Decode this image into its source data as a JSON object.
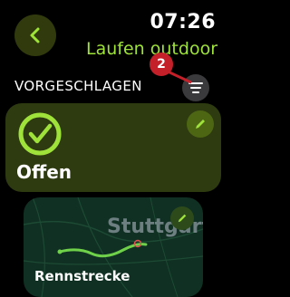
{
  "header": {
    "time": "07:26",
    "title": "Laufen outdoor"
  },
  "section": {
    "label": "VORGESCHLAGEN",
    "badge_count": "2"
  },
  "cards": [
    {
      "title": "Offen"
    },
    {
      "map_label": "Stuttgart",
      "route_name": "Rennstrecke"
    }
  ],
  "colors": {
    "accent": "#9ee23a",
    "badge": "#c4202a",
    "card_bg": "#2e3a10"
  }
}
